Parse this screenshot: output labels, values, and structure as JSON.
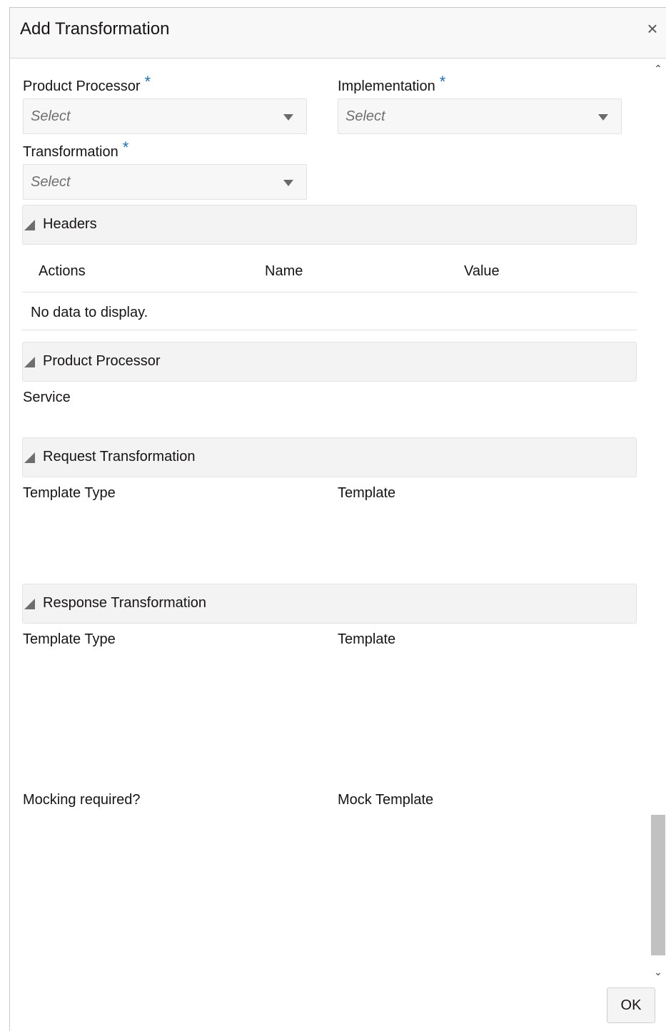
{
  "dialog": {
    "title": "Add Transformation",
    "close_glyph": "×",
    "ok_label": "OK"
  },
  "fields": {
    "product_processor": {
      "label": "Product Processor",
      "required": "*",
      "placeholder": "Select"
    },
    "implementation": {
      "label": "Implementation",
      "required": "*",
      "placeholder": "Select"
    },
    "transformation": {
      "label": "Transformation",
      "required": "*",
      "placeholder": "Select"
    }
  },
  "sections": {
    "headers": {
      "label": "Headers",
      "columns": [
        "Actions",
        "Name",
        "Value"
      ],
      "empty_text": "No data to display."
    },
    "product_processor": {
      "label": "Product Processor",
      "service_label": "Service"
    },
    "request_transformation": {
      "label": "Request Transformation",
      "template_type_label": "Template Type",
      "template_label": "Template"
    },
    "response_transformation": {
      "label": "Response Transformation",
      "template_type_label": "Template Type",
      "template_label": "Template"
    }
  },
  "mocking": {
    "required_label": "Mocking required?",
    "template_label": "Mock Template"
  },
  "scrollbar": {
    "up_glyph": "⌃",
    "down_glyph": "⌄"
  },
  "colors": {
    "required_asterisk": "#1f6fb2",
    "section_bg": "#f3f3f3"
  }
}
